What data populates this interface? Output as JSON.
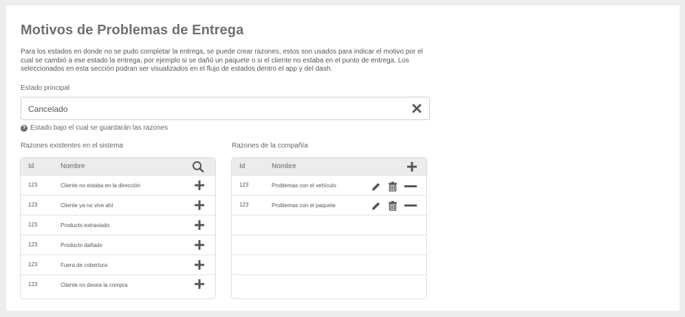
{
  "page": {
    "title": "Motivos de Problemas de Entrega",
    "description": "Para los estados en donde no se pudo completar la entrega, se puede crear razones, estos son usados para indicar el motivo por el cual se cambió a ese estado la entrega, por ejemplo si se dañó un paquete o si el cliente no estaba en el punto de entrega. Los seleccionados en esta sección podran ser visualizados en el flujo de estados dentro el app y del dash."
  },
  "estado": {
    "label": "Estado principal",
    "value": "Cancelado",
    "hint": "Estado bajo el cual se guardarán las razones",
    "hint_icon": "?"
  },
  "existing": {
    "label": "Razones existentes en el sistema",
    "col_id": "Id",
    "col_name": "Nombre",
    "rows": [
      {
        "id": "123",
        "name": "Cliente no estaba en la dirección"
      },
      {
        "id": "123",
        "name": "Cliente ya no vive ahí"
      },
      {
        "id": "123",
        "name": "Producto extraviado"
      },
      {
        "id": "123",
        "name": "Producto dañado"
      },
      {
        "id": "123",
        "name": "Fuera de cobertura"
      },
      {
        "id": "123",
        "name": "Cliente no desea la compra"
      }
    ]
  },
  "company": {
    "label": "Razones de la compañía",
    "col_id": "Id",
    "col_name": "Nombre",
    "rows": [
      {
        "id": "123",
        "name": "Problemas con el vehículo"
      },
      {
        "id": "123",
        "name": "Problemas con el paquete"
      }
    ]
  },
  "icons": {
    "clear": "close-icon",
    "search": "search-icon",
    "add": "plus-icon",
    "edit": "pencil-icon",
    "delete": "trash-icon",
    "remove": "minus-icon",
    "help": "question-circle-icon"
  },
  "colors": {
    "background": "#ededed",
    "card": "#ffffff",
    "header_row": "#ececec",
    "icon": "#555555",
    "title": "#6f6f6f"
  }
}
